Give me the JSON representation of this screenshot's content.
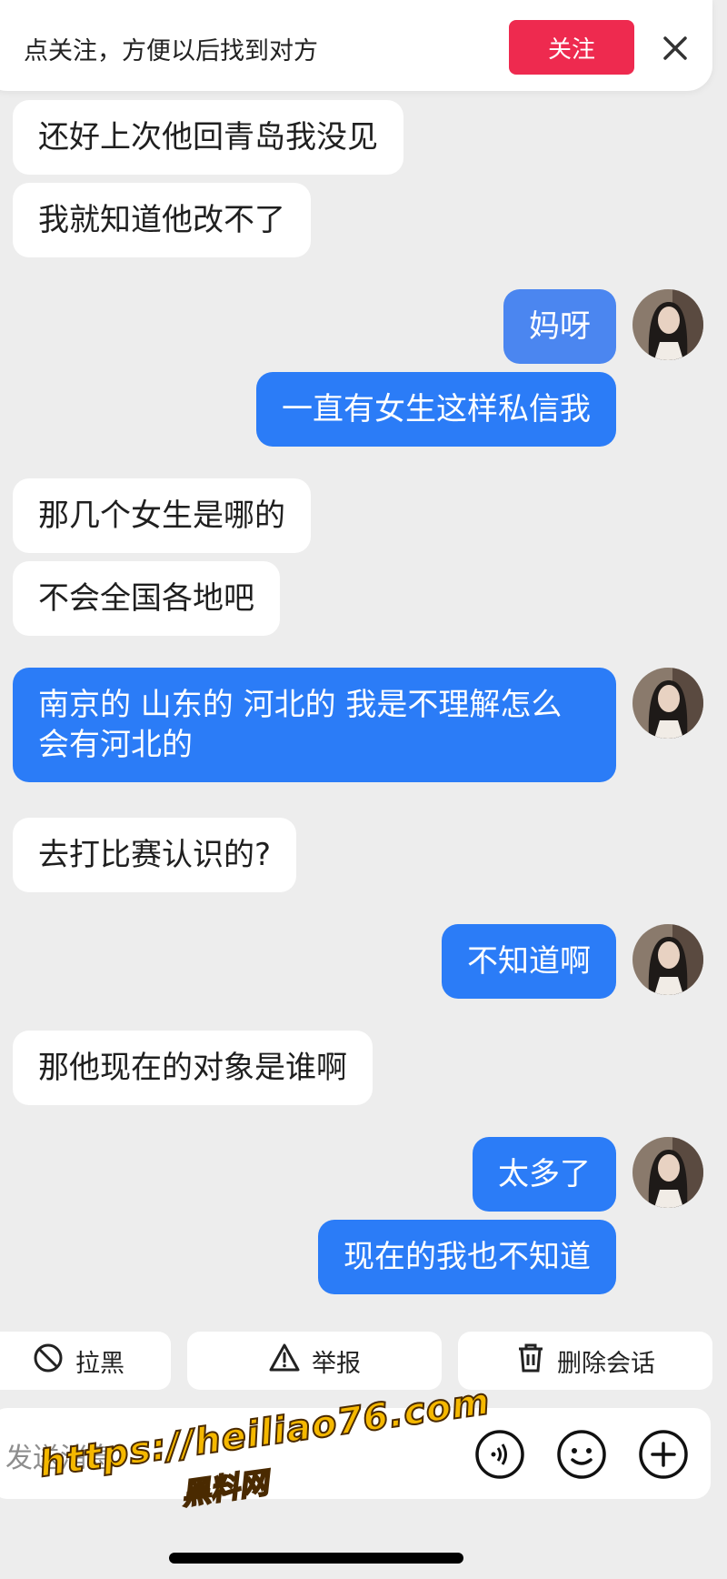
{
  "follow_bar": {
    "prompt": "点关注，方便以后找到对方",
    "follow_label": "关注"
  },
  "messages": [
    {
      "text": "还好上次他回青岛我没见"
    },
    {
      "text": "我就知道他改不了"
    },
    {
      "text": "妈呀"
    },
    {
      "text": "一直有女生这样私信我"
    },
    {
      "text": "那几个女生是哪的"
    },
    {
      "text": "不会全国各地吧"
    },
    {
      "text": "南京的 山东的 河北的 我是不理解怎么会有河北的"
    },
    {
      "text": "去打比赛认识的?"
    },
    {
      "text": "不知道啊"
    },
    {
      "text": "那他现在的对象是谁啊"
    },
    {
      "text": "太多了"
    },
    {
      "text": "现在的我也不知道"
    }
  ],
  "actions": {
    "block": "拉黑",
    "report": "举报",
    "delete": "删除会话"
  },
  "input": {
    "placeholder": "发送消息"
  },
  "watermark": {
    "url": "https://heiliao76.com",
    "name": "黑料网"
  },
  "colors": {
    "outgoing_bubble": "#2b7cf7",
    "follow_button": "#ee2a4f",
    "background": "#ededed"
  },
  "icons": [
    "close-icon",
    "block-icon",
    "warning-icon",
    "trash-icon",
    "voice-icon",
    "emoji-icon",
    "plus-icon"
  ]
}
